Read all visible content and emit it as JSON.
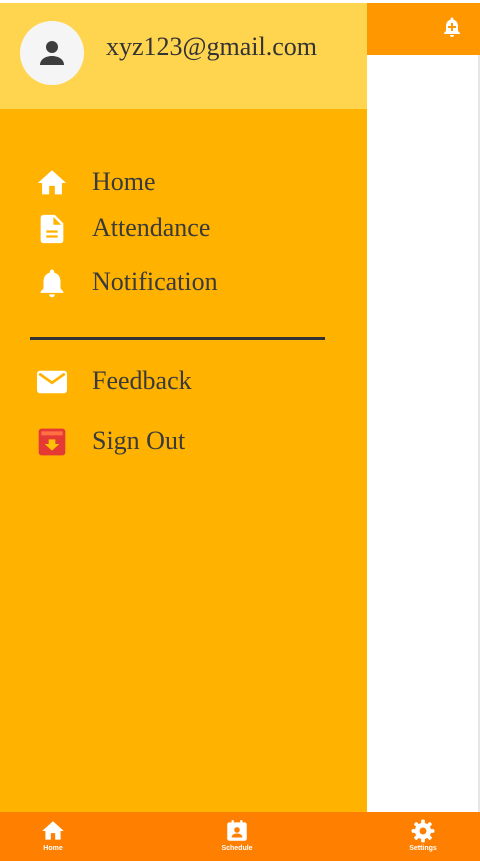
{
  "user": {
    "email": "xyz123@gmail.com",
    "avatar_icon": "person-icon"
  },
  "appbar": {
    "action_icon": "bell-plus-icon"
  },
  "menu": {
    "items": [
      {
        "label": "Home",
        "icon": "home-icon"
      },
      {
        "label": "Attendance",
        "icon": "document-icon"
      },
      {
        "label": "Notification",
        "icon": "bell-icon"
      },
      {
        "label": "Feedback",
        "icon": "mail-icon"
      },
      {
        "label": "Sign Out",
        "icon": "sign-out-icon"
      }
    ]
  },
  "bottom_nav": {
    "items": [
      {
        "label": "Home",
        "icon": "home-icon"
      },
      {
        "label": "Schedule",
        "icon": "schedule-icon"
      },
      {
        "label": "Settings",
        "icon": "settings-icon"
      }
    ]
  },
  "colors": {
    "drawer": "#ffb300",
    "drawer_header": "#ffd54f",
    "appbar": "#ff9800",
    "bottom_nav": "#ff8000",
    "sign_out_icon": "#e53935"
  }
}
